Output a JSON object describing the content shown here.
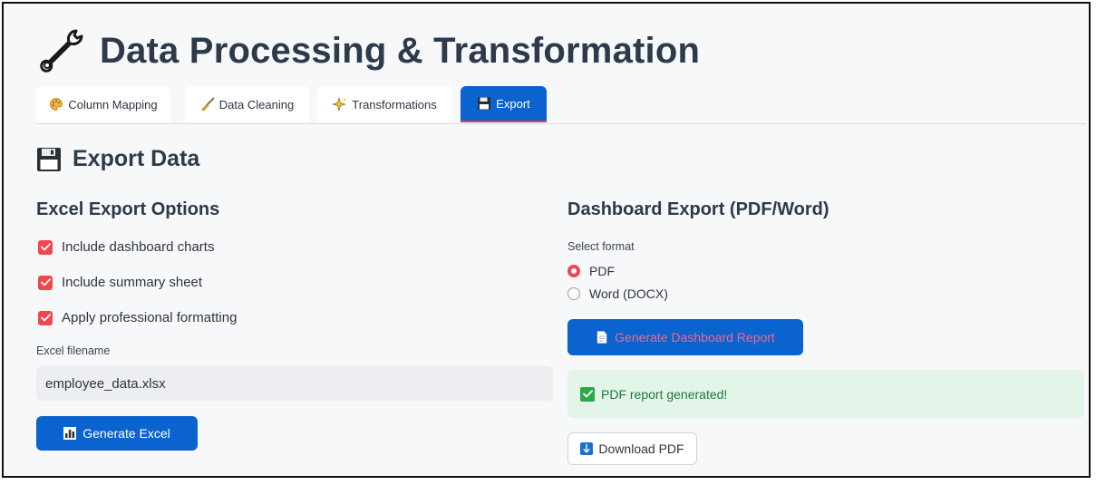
{
  "page": {
    "title": "Data Processing & Transformation",
    "title_icon": "wrench-icon"
  },
  "tabs": [
    {
      "label": "Column Mapping",
      "icon": "palette-icon",
      "active": false
    },
    {
      "label": "Data Cleaning",
      "icon": "broom-icon",
      "active": false
    },
    {
      "label": "Transformations",
      "icon": "sparkles-icon",
      "active": false
    },
    {
      "label": "Export",
      "icon": "floppy-disk-icon",
      "active": true
    }
  ],
  "section": {
    "title": "Export Data",
    "icon": "floppy-disk-icon"
  },
  "excel": {
    "heading": "Excel Export Options",
    "options": [
      {
        "label": "Include dashboard charts",
        "checked": true
      },
      {
        "label": "Include summary sheet",
        "checked": true
      },
      {
        "label": "Apply professional formatting",
        "checked": true
      }
    ],
    "filename_label": "Excel filename",
    "filename_value": "employee_data.xlsx",
    "generate_label": "Generate Excel",
    "generate_icon": "bar-chart-icon"
  },
  "dashboard": {
    "heading": "Dashboard Export (PDF/Word)",
    "format_label": "Select format",
    "formats": [
      {
        "label": "PDF",
        "selected": true
      },
      {
        "label": "Word (DOCX)",
        "selected": false
      }
    ],
    "generate_label": "Generate Dashboard Report",
    "generate_icon": "document-icon",
    "success_message": "PDF report generated!",
    "success_icon": "check-mark-icon",
    "download_label": "Download PDF",
    "download_icon": "download-arrow-icon"
  },
  "colors": {
    "primary": "#0a63cf",
    "accent": "#f0474f",
    "success_bg": "#e3f4e8",
    "success_text": "#1e7a3c",
    "heading": "#2c3a4b"
  }
}
